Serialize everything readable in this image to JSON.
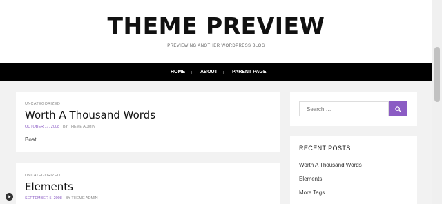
{
  "site": {
    "title": "THEME PREVIEW",
    "description": "PREVIEWING ANOTHER WORDPRESS BLOG"
  },
  "nav": {
    "items": [
      {
        "label": "HOME"
      },
      {
        "label": "ABOUT"
      },
      {
        "label": "PARENT PAGE"
      }
    ]
  },
  "posts": [
    {
      "category": "UNCATEGORIZED",
      "title": "Worth A Thousand Words",
      "date": "OCTOBER 17, 2008",
      "author": "BY THEME ADMIN",
      "excerpt": "Boat."
    },
    {
      "category": "UNCATEGORIZED",
      "title": "Elements",
      "date": "SEPTEMBER 5, 2008",
      "author": "BY THEME ADMIN"
    }
  ],
  "sidebar": {
    "search_placeholder": "Search …",
    "recent_title": "RECENT POSTS",
    "recent_posts": [
      {
        "label": "Worth A Thousand Words"
      },
      {
        "label": "Elements"
      },
      {
        "label": "More Tags"
      }
    ]
  },
  "colors": {
    "accent": "#8b5cc4",
    "nav_bg": "#000000",
    "page_bg": "#f2f2f2"
  }
}
